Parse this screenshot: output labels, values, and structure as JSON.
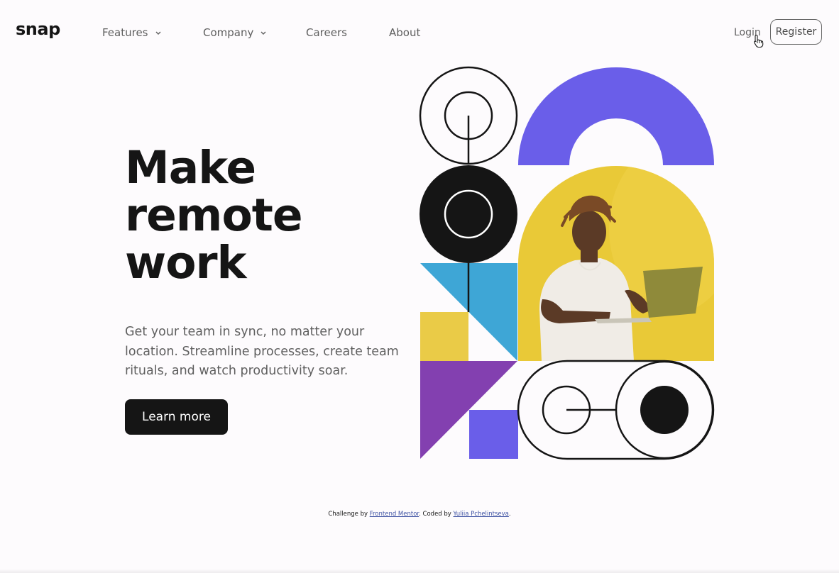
{
  "brand": {
    "logo_text": "snap"
  },
  "nav": {
    "items": [
      {
        "label": "Features",
        "has_dropdown": true
      },
      {
        "label": "Company",
        "has_dropdown": true
      },
      {
        "label": "Careers",
        "has_dropdown": false
      },
      {
        "label": "About",
        "has_dropdown": false
      }
    ],
    "login_label": "Login",
    "register_label": "Register"
  },
  "hero": {
    "title_lines": [
      "Make",
      "remote",
      "work"
    ],
    "description": "Get your team in sync, no matter your location. Streamline processes, create team rituals, and watch productivity soar.",
    "cta_label": "Learn more"
  },
  "footer": {
    "prefix": "Challenge by ",
    "link1": "Frontend Mentor",
    "middle": ". Coded by ",
    "link2": "Yuliia Pchelintseva",
    "suffix": "."
  },
  "colors": {
    "background": "#fdfbfd",
    "text_dark": "#151515",
    "text_gray": "#5f5f5f",
    "accent_indigo": "#6a5ee9",
    "accent_blue": "#3ea6d6",
    "accent_yellow": "#eacb47",
    "accent_purple": "#8340b0"
  },
  "icons": {
    "dropdown": "chevron-down-icon",
    "cursor": "hand-pointer-icon"
  }
}
